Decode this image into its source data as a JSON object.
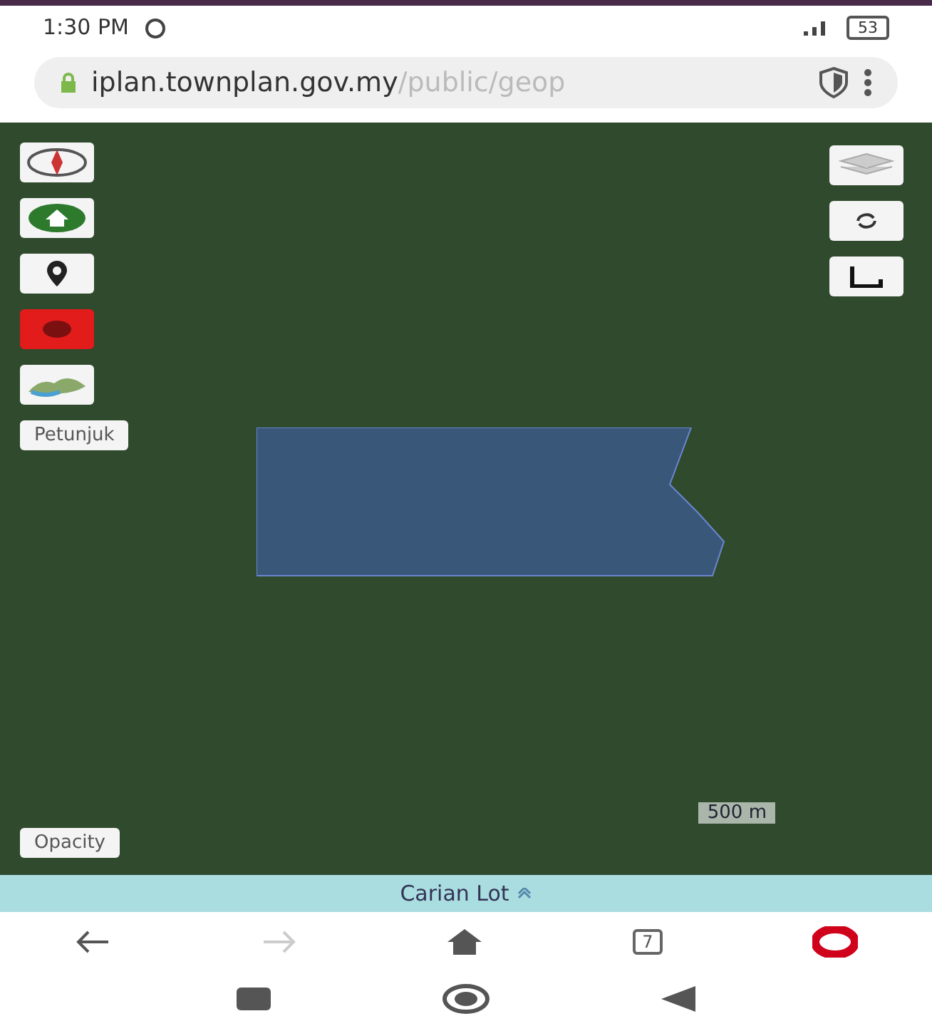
{
  "status_bar": {
    "time": "1:30 PM",
    "battery": "53"
  },
  "address_bar": {
    "domain": "iplan.townplan.gov.my",
    "path": "/public/geop"
  },
  "map": {
    "left_controls": [
      {
        "kind": "compass"
      },
      {
        "kind": "home"
      },
      {
        "kind": "pin"
      },
      {
        "kind": "record"
      },
      {
        "kind": "basemap"
      }
    ],
    "legend_button": "Petunjuk",
    "right_controls": [
      {
        "kind": "layers"
      },
      {
        "kind": "refresh"
      },
      {
        "kind": "measure"
      }
    ],
    "opacity_button": "Opacity",
    "scale": "500 m"
  },
  "search_panel": {
    "label": "Carian Lot"
  },
  "browser_nav": {
    "tab_count": "7"
  }
}
